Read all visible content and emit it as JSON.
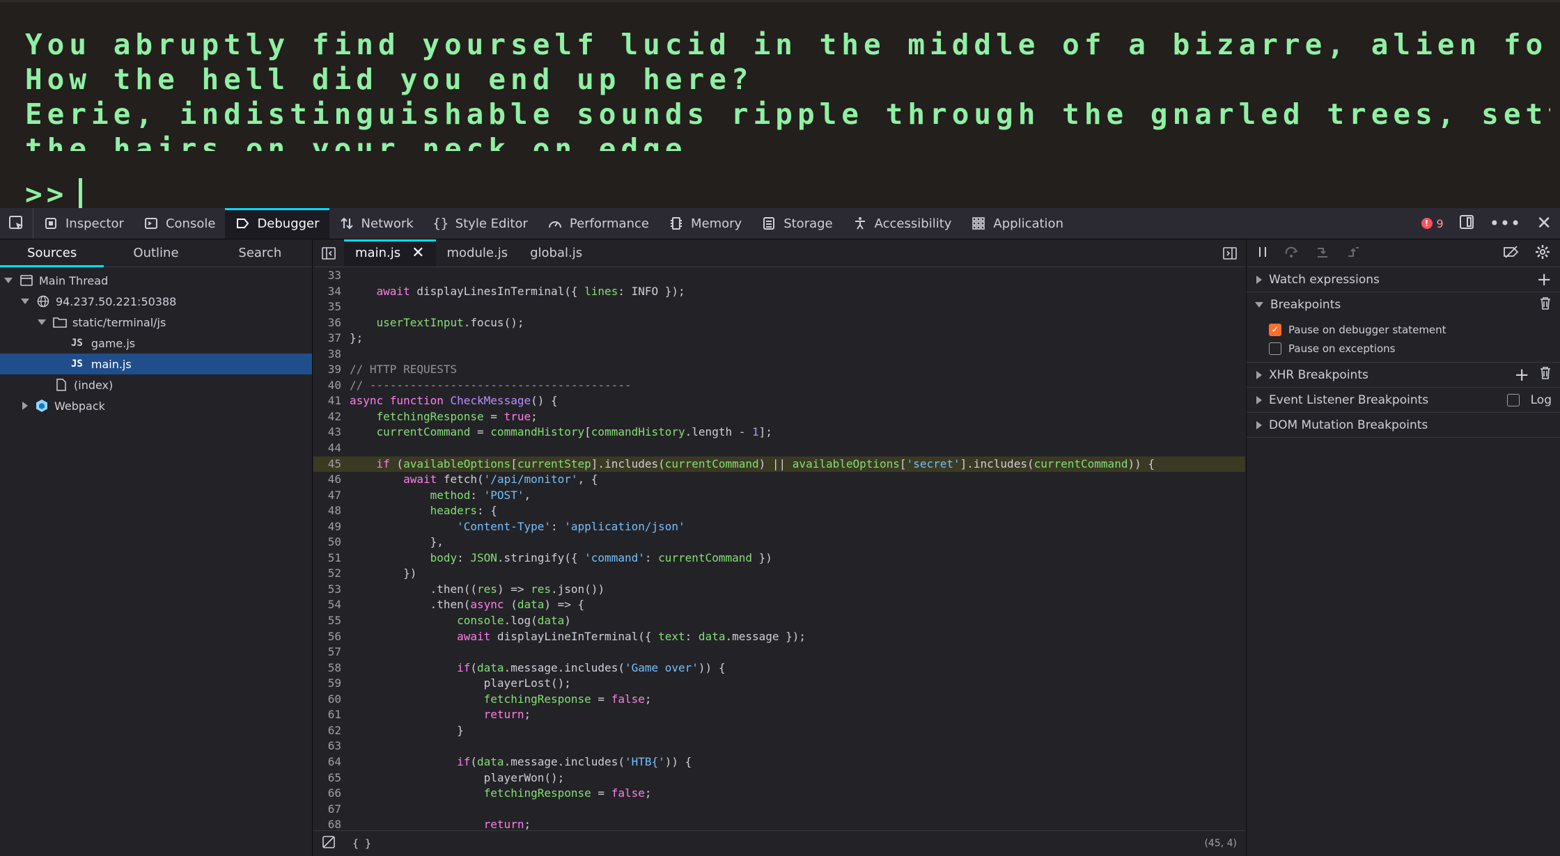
{
  "terminal": {
    "lines": [
      "You abruptly find yourself lucid in the middle of a bizarre, alien forest.",
      "How the hell did you end up here?",
      "Eerie, indistinguishable sounds ripple through the gnarled trees, setting",
      "the hairs on your neck on edge."
    ],
    "prompt": ">>"
  },
  "toolbar": {
    "tabs": [
      "Inspector",
      "Console",
      "Debugger",
      "Network",
      "Style Editor",
      "Performance",
      "Memory",
      "Storage",
      "Accessibility",
      "Application"
    ],
    "selected_tab": "Debugger",
    "error_count": "9"
  },
  "sources": {
    "subtabs": [
      "Sources",
      "Outline",
      "Search"
    ],
    "tree": {
      "main_thread": "Main Thread",
      "host": "94.237.50.221:50388",
      "folder": "static/terminal/js",
      "file_tag": "JS",
      "files": [
        "game.js",
        "main.js"
      ],
      "index": "(index)",
      "webpack": "Webpack"
    }
  },
  "editor": {
    "tabs": [
      "main.js",
      "module.js",
      "global.js"
    ],
    "cursor_position": "(45, 4)",
    "format_label": "{ }",
    "paused_line": 45
  },
  "right": {
    "watch": "Watch expressions",
    "breakpoints": "Breakpoints",
    "pause_debugger": "Pause on debugger statement",
    "pause_exceptions": "Pause on exceptions",
    "xhr": "XHR Breakpoints",
    "event_listener": "Event Listener Breakpoints",
    "log": "Log",
    "dom_mutation": "DOM Mutation Breakpoints"
  }
}
